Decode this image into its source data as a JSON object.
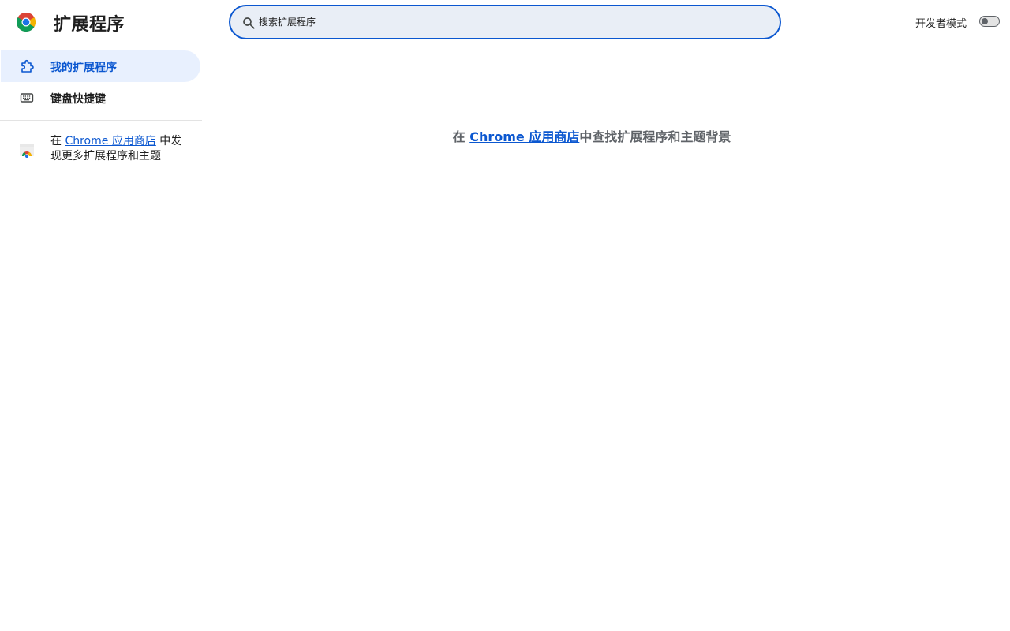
{
  "header": {
    "title": "扩展程序",
    "logo_icon": "chrome-logo-icon"
  },
  "search": {
    "placeholder": "搜索扩展程序",
    "value": "",
    "icon": "search-icon"
  },
  "developer_mode": {
    "label": "开发者模式",
    "enabled": false
  },
  "sidebar": {
    "items": [
      {
        "label": "我的扩展程序",
        "icon": "puzzle-piece-icon",
        "active": true
      },
      {
        "label": "键盘快捷键",
        "icon": "keyboard-icon",
        "active": false
      }
    ],
    "store_promo": {
      "prefix": "在 ",
      "link_text": "Chrome 应用商店",
      "suffix": " 中发现更多扩展程序和主题",
      "icon": "chrome-web-store-icon"
    }
  },
  "main": {
    "prefix": "在 ",
    "link_text": "Chrome 应用商店",
    "suffix": "中查找扩展程序和主题背景"
  },
  "colors": {
    "accent": "#0b57d0",
    "active_nav_bg": "#e8f0fe",
    "search_bg": "#e9eef6",
    "muted_text": "#5f6368"
  }
}
